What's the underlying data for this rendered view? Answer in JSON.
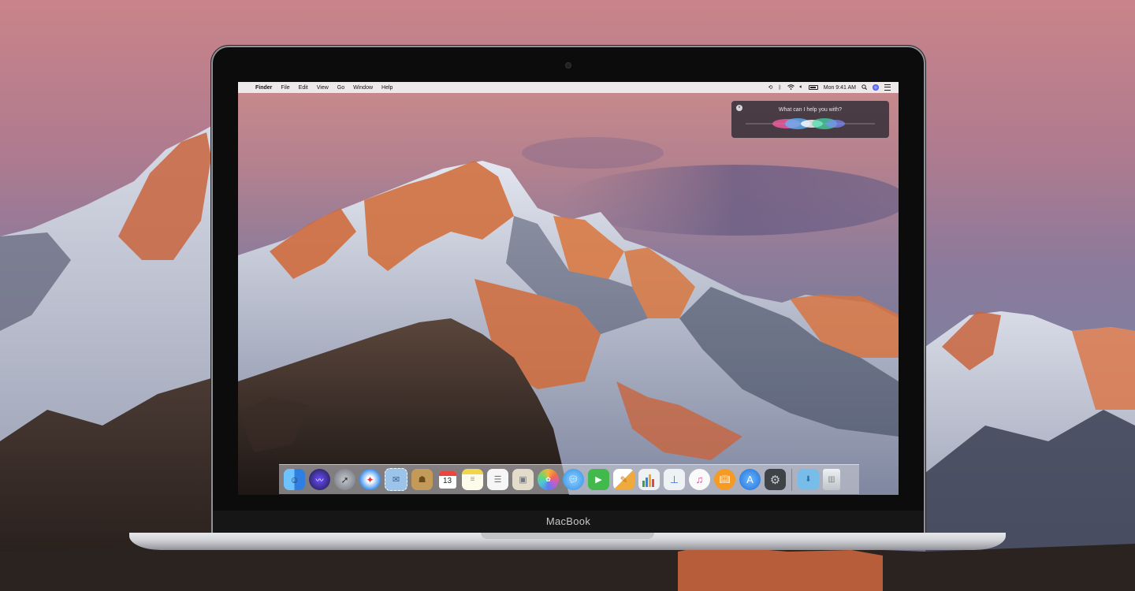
{
  "laptop": {
    "brand": "MacBook"
  },
  "menubar": {
    "apple_glyph": "",
    "items": [
      "Finder",
      "File",
      "Edit",
      "View",
      "Go",
      "Window",
      "Help"
    ],
    "clock": "Mon 9:41 AM",
    "status_icons": [
      "time-machine-icon",
      "bluetooth-icon",
      "wifi-icon",
      "volume-icon",
      "battery-icon",
      "spotlight-icon",
      "siri-icon",
      "notification-center-icon"
    ]
  },
  "siri": {
    "prompt": "What can I help you with?",
    "close_glyph": "×"
  },
  "dock": {
    "calendar_day": "13",
    "apps": [
      {
        "name": "finder",
        "icon": "finder-icon",
        "color": "#3a8ee6"
      },
      {
        "name": "siri",
        "icon": "siri-icon",
        "color": "#2c2c5a"
      },
      {
        "name": "launchpad",
        "icon": "rocket-icon",
        "color": "#8b9096"
      },
      {
        "name": "safari",
        "icon": "compass-icon",
        "color": "#2f86e9"
      },
      {
        "name": "mail",
        "icon": "stamp-icon",
        "color": "#6fa5d9"
      },
      {
        "name": "contacts",
        "icon": "address-book-icon",
        "color": "#b58a4c"
      },
      {
        "name": "calendar",
        "icon": "calendar-icon",
        "color": "#ffffff"
      },
      {
        "name": "notes",
        "icon": "notes-icon",
        "color": "#f6e27a"
      },
      {
        "name": "reminders",
        "icon": "checklist-icon",
        "color": "#f2f2f2"
      },
      {
        "name": "preview",
        "icon": "photo-stack-icon",
        "color": "#d8d2c0"
      },
      {
        "name": "photos",
        "icon": "pinwheel-icon",
        "color": "#ffffff"
      },
      {
        "name": "messages",
        "icon": "speech-bubble-icon",
        "color": "#4aa6f4"
      },
      {
        "name": "facetime",
        "icon": "video-camera-icon",
        "color": "#3ec24a"
      },
      {
        "name": "pages",
        "icon": "pen-icon",
        "color": "#e7a23a"
      },
      {
        "name": "numbers",
        "icon": "bar-chart-icon",
        "color": "#e9eef2"
      },
      {
        "name": "keynote",
        "icon": "podium-icon",
        "color": "#3d7ee3"
      },
      {
        "name": "itunes",
        "icon": "music-note-icon",
        "color": "#f4f4f4"
      },
      {
        "name": "ibooks",
        "icon": "book-icon",
        "color": "#f49b2a"
      },
      {
        "name": "app-store",
        "icon": "app-store-icon",
        "color": "#2e7fe6"
      },
      {
        "name": "system-preferences",
        "icon": "gear-icon",
        "color": "#7b7f86"
      },
      {
        "name": "downloads",
        "icon": "folder-icon",
        "color": "#6fb7e8"
      },
      {
        "name": "trash",
        "icon": "trash-icon",
        "color": "#d9dde2"
      }
    ]
  }
}
